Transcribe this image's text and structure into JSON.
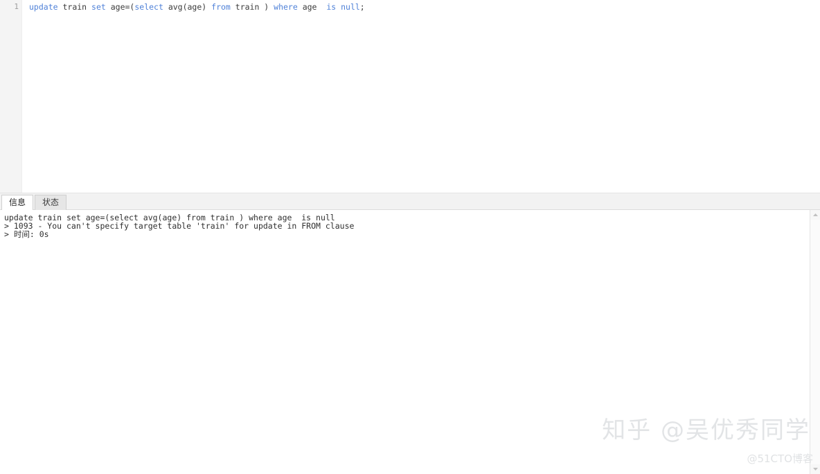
{
  "editor": {
    "line_numbers": [
      "1"
    ],
    "statement_tokens": [
      {
        "text": "update",
        "kind": "keyword"
      },
      {
        "text": " train ",
        "kind": "plain"
      },
      {
        "text": "set",
        "kind": "keyword"
      },
      {
        "text": " age=(",
        "kind": "plain"
      },
      {
        "text": "select",
        "kind": "keyword"
      },
      {
        "text": " avg(age) ",
        "kind": "plain"
      },
      {
        "text": "from",
        "kind": "keyword"
      },
      {
        "text": " train ) ",
        "kind": "plain"
      },
      {
        "text": "where",
        "kind": "keyword"
      },
      {
        "text": " age  ",
        "kind": "plain"
      },
      {
        "text": "is null",
        "kind": "keyword"
      },
      {
        "text": ";",
        "kind": "plain"
      }
    ],
    "statement_plain": "update train set age=(select avg(age) from train ) where age  is null;"
  },
  "tabs": [
    {
      "label": "信息",
      "active": true
    },
    {
      "label": "状态",
      "active": false
    }
  ],
  "results": {
    "lines": [
      "update train set age=(select avg(age) from train ) where age  is null",
      "> 1093 - You can't specify target table 'train' for update in FROM clause",
      "> 时间: 0s"
    ]
  },
  "scrollbar": {
    "up_arrow": "scroll-up-icon",
    "down_arrow": "scroll-down-icon"
  },
  "watermarks": {
    "main": "知乎 @吴优秀同学",
    "sub": "@51CTO博客"
  },
  "colors": {
    "keyword": "#4f81d8",
    "code_text": "#3a3a3a",
    "gutter_bg": "#f4f4f4",
    "gutter_text": "#9d9d9d",
    "tab_active_bg": "#ffffff",
    "tab_inactive_bg": "#e6e6e6",
    "watermark": "#e2e4e6"
  }
}
